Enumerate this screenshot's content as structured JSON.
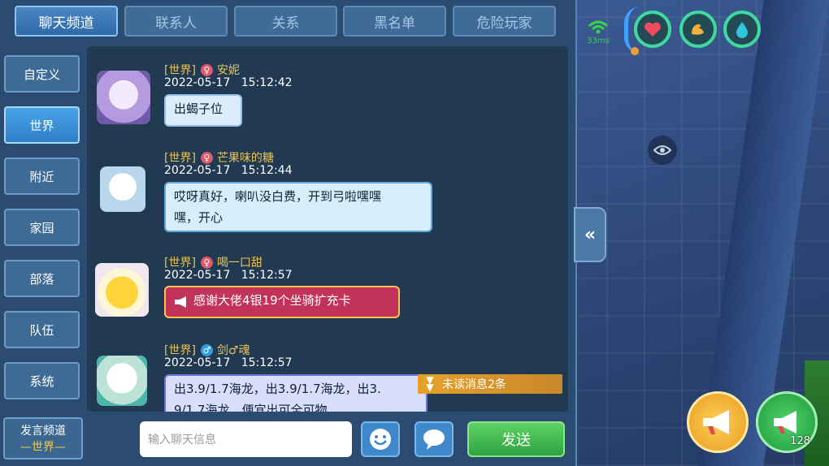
{
  "tabs": [
    {
      "label": "聊天频道",
      "active": true
    },
    {
      "label": "联系人",
      "active": false
    },
    {
      "label": "关系",
      "active": false
    },
    {
      "label": "黑名单",
      "active": false
    },
    {
      "label": "危险玩家",
      "active": false
    }
  ],
  "sidebar": [
    {
      "label": "自定义",
      "active": false
    },
    {
      "label": "世界",
      "active": true
    },
    {
      "label": "附近",
      "active": false
    },
    {
      "label": "家园",
      "active": false
    },
    {
      "label": "部落",
      "active": false
    },
    {
      "label": "队伍",
      "active": false
    },
    {
      "label": "系统",
      "active": false
    }
  ],
  "messages": [
    {
      "channel": "[世界]",
      "sex": "female",
      "name": "安妮",
      "time": "2022-05-17   15:12:42",
      "lines": [
        "出蝎子位"
      ],
      "style": "light"
    },
    {
      "channel": "[世界]",
      "sex": "female",
      "name": "芒果味的糖",
      "time": "2022-05-17   15:12:44",
      "lines": [
        "哎呀真好，喇叭没白费，开到弓啦嘿嘿",
        "嘿，开心"
      ],
      "style": "blue"
    },
    {
      "channel": "[世界]",
      "sex": "female",
      "name": "喝一口甜",
      "time": "2022-05-17   15:12:57",
      "lines": [
        "感谢大佬4银19个坐骑扩充卡"
      ],
      "style": "horn"
    },
    {
      "channel": "[世界]",
      "sex": "male",
      "name": "剑♂魂",
      "time": "2022-05-17   15:12:57",
      "lines": [
        "出3.9/1.7海龙，出3.9/1.7海龙，出3.",
        "9/1.7海龙，便宜出可全可物"
      ],
      "style": "purple"
    }
  ],
  "unread": "未读消息2条",
  "send_channel": {
    "title": "发言频道",
    "value": "—世界—"
  },
  "input": {
    "placeholder": "输入聊天信息"
  },
  "send_label": "发送",
  "hud": {
    "ping": "33ms",
    "horn_count": "128"
  },
  "colors": {
    "gold": "#e8c25a",
    "female": "#e2566c",
    "male": "#2f9fe0",
    "accent": "#3fd8a0"
  }
}
